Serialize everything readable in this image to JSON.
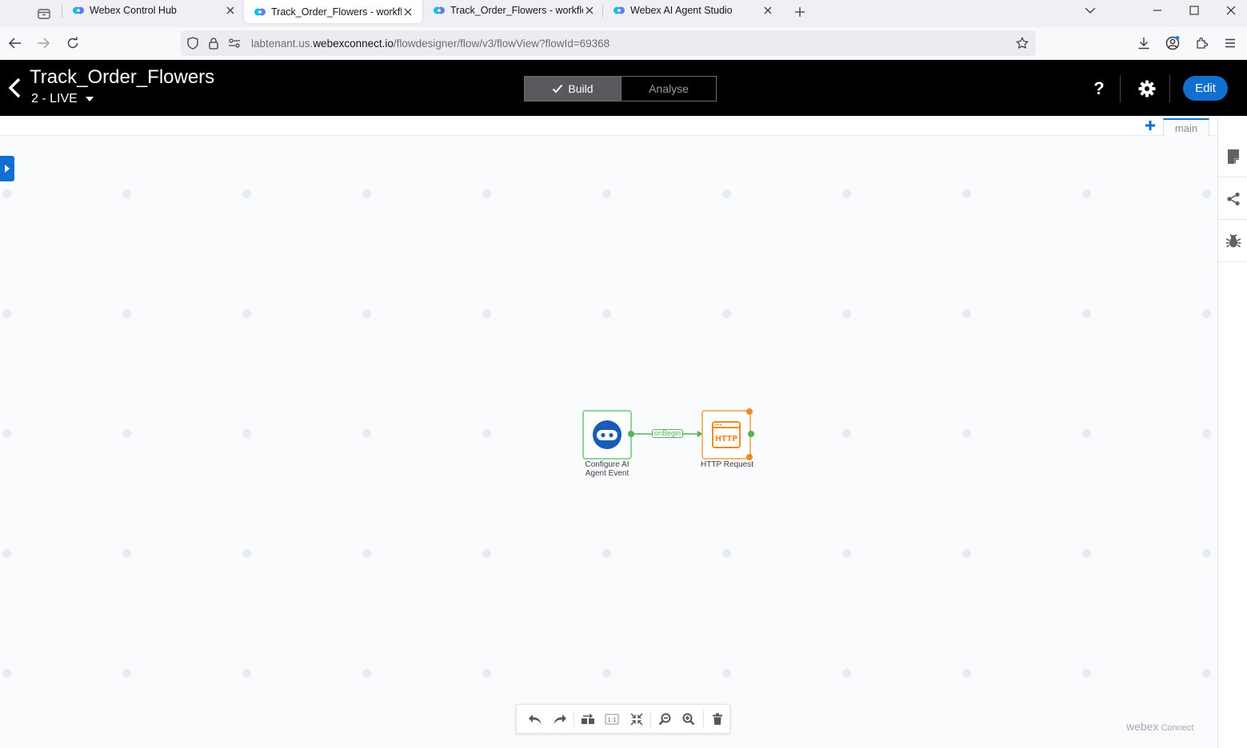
{
  "browser": {
    "tabs": [
      {
        "title": "Webex Control Hub",
        "active": false
      },
      {
        "title": "Track_Order_Flowers - workflow",
        "active": true
      },
      {
        "title": "Track_Order_Flowers - workflow",
        "active": false
      },
      {
        "title": "Webex AI Agent Studio",
        "active": false
      }
    ],
    "url_prefix": "labtenant.us.",
    "url_domain": "webexconnect.io",
    "url_path": "/flowdesigner/flow/v3/flowView?flowId=69368"
  },
  "header": {
    "flow_name": "Track_Order_Flowers",
    "version": "2 - LIVE",
    "build_label": "Build",
    "analyse_label": "Analyse",
    "help_label": "?",
    "edit_label": "Edit"
  },
  "canvas": {
    "sheet_tab": "main",
    "nodes": {
      "start": {
        "label_line1": "Configure AI",
        "label_line2": "Agent Event"
      },
      "http": {
        "label": "HTTP Request",
        "badge": "HTTP"
      }
    },
    "connector_label": "onBegin",
    "brand_main": "webex",
    "brand_sub": "Connect"
  },
  "colors": {
    "accent": "#1170cf",
    "start_node_border": "#8fd694",
    "http_node_border": "#f2b870",
    "connector": "#55b25b",
    "http_port": "#f08a24"
  }
}
